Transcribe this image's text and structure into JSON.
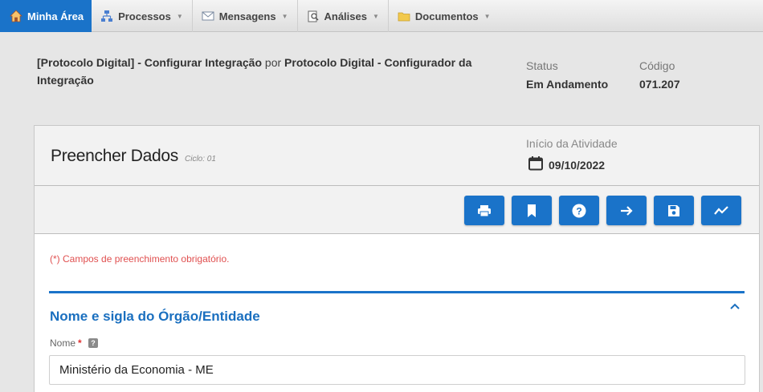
{
  "nav": {
    "items": [
      {
        "label": "Minha Área",
        "icon": "home-icon"
      },
      {
        "label": "Processos",
        "icon": "processes-icon"
      },
      {
        "label": "Mensagens",
        "icon": "envelope-icon"
      },
      {
        "label": "Análises",
        "icon": "analysis-icon"
      },
      {
        "label": "Documentos",
        "icon": "folder-icon"
      }
    ]
  },
  "header": {
    "title_part1": "[Protocolo Digital] - Configurar Integração",
    "title_connector": "por",
    "title_part2": "Protocolo Digital - Configurador da Integração",
    "status_label": "Status",
    "status_value": "Em Andamento",
    "code_label": "Código",
    "code_value": "071.207"
  },
  "card": {
    "title": "Preencher Dados",
    "cycle": "Ciclo: 01",
    "start_label": "Início da Atividade",
    "start_value": "09/10/2022"
  },
  "toolbar": {
    "buttons": [
      "print-icon",
      "bookmark-icon",
      "help-icon",
      "arrow-right-icon",
      "save-icon",
      "chart-icon"
    ]
  },
  "form": {
    "required_note": "(*) Campos de preenchimento obrigatório.",
    "section_title": "Nome e sigla do Órgão/Entidade",
    "name_label": "Nome",
    "name_required": "*",
    "help_glyph": "?",
    "name_value": "Ministério da Economia - ME"
  },
  "colors": {
    "accent": "#1a73c9",
    "required": "#e05050"
  }
}
